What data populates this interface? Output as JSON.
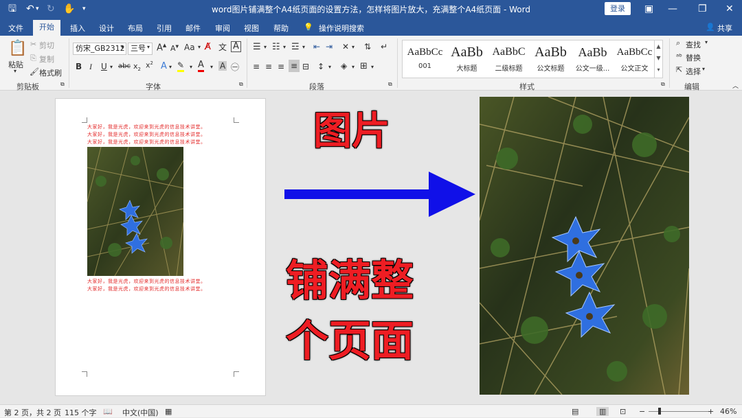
{
  "titlebar": {
    "title": "word图片铺满整个A4纸页面的设置方法，怎样将图片放大，充满整个A4纸页面  -  Word",
    "login": "登录"
  },
  "tabs": [
    "文件",
    "开始",
    "插入",
    "设计",
    "布局",
    "引用",
    "邮件",
    "审阅",
    "视图",
    "帮助",
    "操作说明搜索",
    "共享"
  ],
  "ribbon": {
    "clipboard": {
      "paste": "粘贴",
      "cut": "剪切",
      "copy": "复制",
      "format_painter": "格式刷",
      "label": "剪贴板"
    },
    "font": {
      "font_name": "仿宋_GB2312",
      "font_size": "三号",
      "case": "Aa",
      "label": "字体"
    },
    "paragraph": {
      "label": "段落"
    },
    "styles": {
      "items": [
        {
          "preview": "AaBbCc",
          "name": "001"
        },
        {
          "preview": "AaBb",
          "name": "大标题"
        },
        {
          "preview": "AaBbC",
          "name": "二级标题"
        },
        {
          "preview": "AaBb",
          "name": "公文标题"
        },
        {
          "preview": "AaBb",
          "name": "公文一级..."
        },
        {
          "preview": "AaBbCc",
          "name": "公文正文"
        }
      ],
      "label": "样式"
    },
    "editing": {
      "find": "查找",
      "replace": "替换",
      "select": "选择",
      "label": "编辑"
    }
  },
  "document": {
    "lines_top": [
      "大家好，我是光虎，欢迎来到光虎的信息技术讲堂。",
      "大家好，我是光虎，欢迎来到光虎的信息技术讲堂。",
      "大家好，我是光虎，欢迎来到光虎的信息技术讲堂。"
    ],
    "lines_bottom": [
      "大家好，我是光虎，欢迎来到光虎的信息技术讲堂。",
      "大家好，我是光虎，欢迎来到光虎的信息技术讲堂。"
    ]
  },
  "overlay": {
    "heading": "图片",
    "line1": "铺满整",
    "line2": "个页面"
  },
  "status": {
    "page": "第 2 页，共 2 页",
    "words": "115 个字",
    "lang": "中文(中国)",
    "zoom": "46%"
  },
  "colors": {
    "brand": "#2b579a",
    "arrow": "#1010e8",
    "overlay_text": "#ee1d23"
  }
}
